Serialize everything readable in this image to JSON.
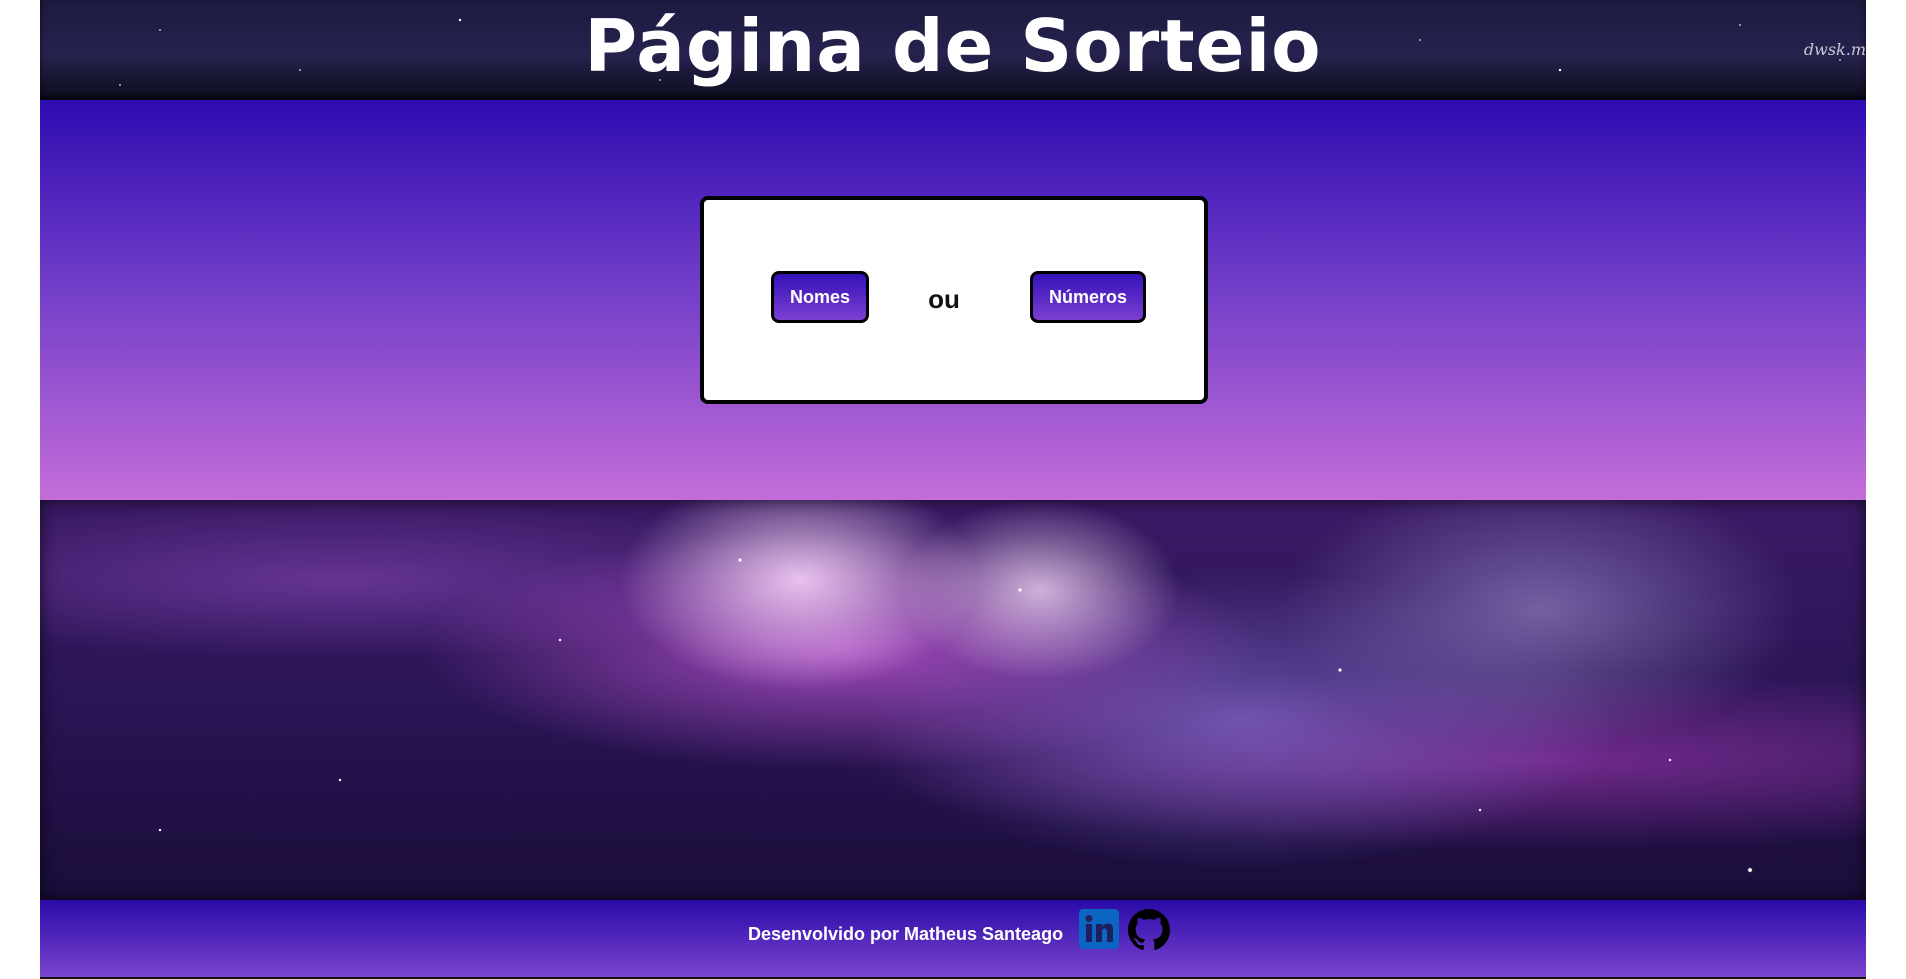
{
  "header": {
    "title": "Página de Sorteio",
    "watermark": "dwsk.m"
  },
  "card": {
    "names_button": "Nomes",
    "separator": "ou",
    "numbers_button": "Números"
  },
  "footer": {
    "credit": "Desenvolvido por Matheus Santeago",
    "icons": [
      "linkedin-icon",
      "github-icon"
    ]
  },
  "colors": {
    "primary": "#2e0bb0",
    "gradient_end": "#c46dd9",
    "linkedin": "#0a66c2"
  }
}
